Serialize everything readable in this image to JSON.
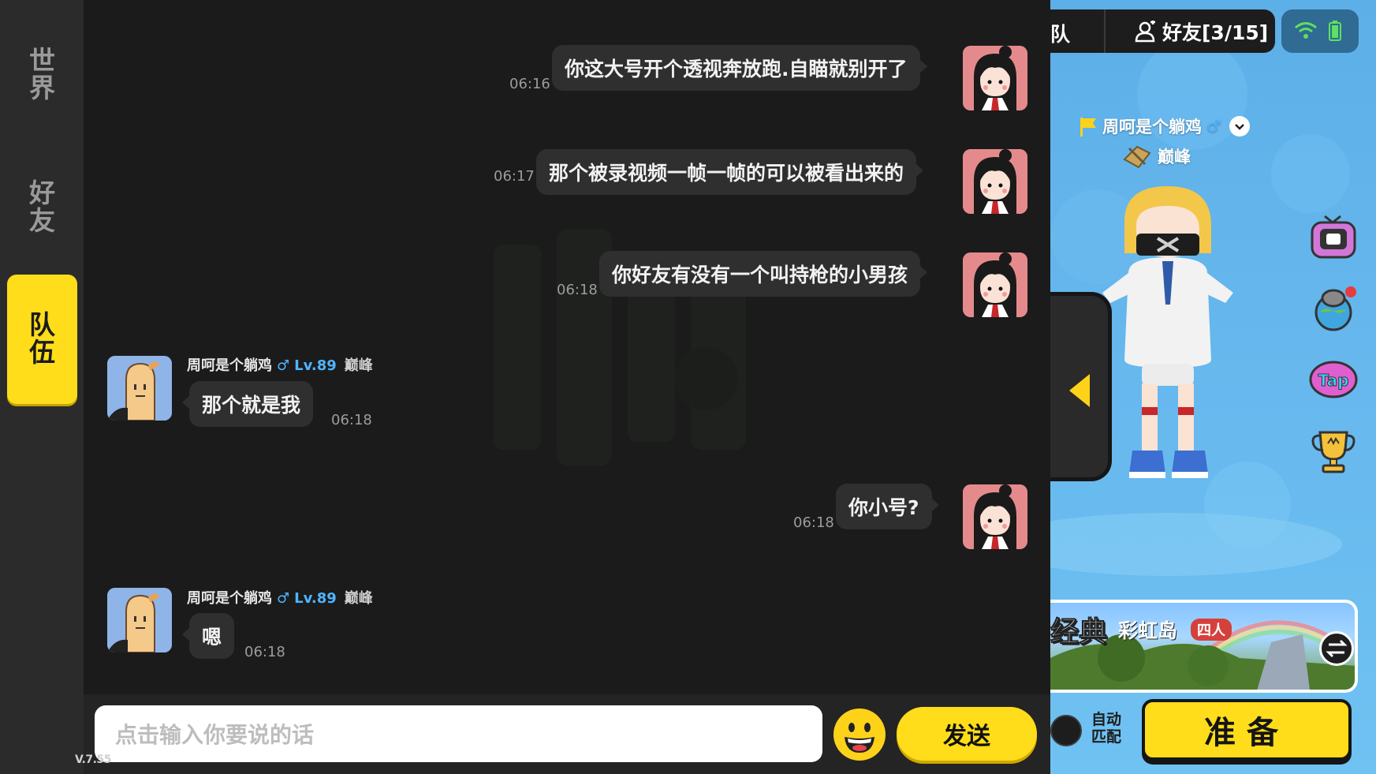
{
  "version": "V.7.55",
  "rail": {
    "world": [
      "世",
      "界"
    ],
    "friends": [
      "好",
      "友"
    ],
    "team": [
      "队",
      "伍"
    ]
  },
  "messages": [
    {
      "side": "right",
      "text": "你这大号开个透视奔放跑.自瞄就别开了",
      "time": "06:16"
    },
    {
      "side": "right",
      "text": "那个被录视频一帧一帧的可以被看出来的",
      "time": "06:17"
    },
    {
      "side": "right",
      "text": "你好友有没有一个叫持枪的小男孩",
      "time": "06:18"
    },
    {
      "side": "left",
      "sender": "周呵是个躺鸡",
      "gender": "♂",
      "level": "Lv.89",
      "rank": "巅峰",
      "text": "那个就是我",
      "time": "06:18"
    },
    {
      "side": "right",
      "text": "你小号?",
      "time": "06:18"
    },
    {
      "side": "left",
      "sender": "周呵是个躺鸡",
      "gender": "♂",
      "level": "Lv.89",
      "rank": "巅峰",
      "text": "嗯",
      "time": "06:18"
    }
  ],
  "input": {
    "placeholder": "点击输入你要说的话",
    "send_label": "发送",
    "emoji_icon": "smiley-emoji-icon"
  },
  "game": {
    "topbar": {
      "team_label": "队",
      "friends_label": "好友[3/15]"
    },
    "player": {
      "name": "周呵是个躺鸡",
      "gender": "♂",
      "rank": "巅峰"
    },
    "mode": {
      "title": "经典",
      "map": "彩虹岛",
      "size": "四人"
    },
    "auto_match_label": [
      "自动",
      "匹配"
    ],
    "ready_label": "准备"
  },
  "colors": {
    "accent_yellow": "#ffdd1a",
    "bubble": "#2f2f2f",
    "link_blue": "#4fb4ff",
    "sky": "#5dafe8"
  }
}
